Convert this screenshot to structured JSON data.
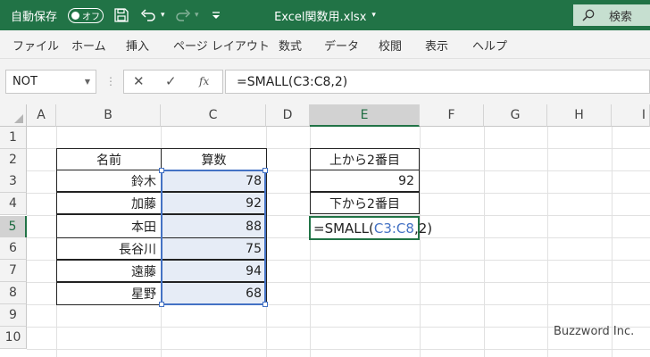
{
  "titlebar": {
    "autosave_label": "自動保存",
    "autosave_state": "オフ",
    "filename": "Excel関数用.xlsx",
    "search_label": "検索",
    "bg_color": "#217346"
  },
  "ribbon": {
    "tabs": [
      "ファイル",
      "ホーム",
      "挿入",
      "ページ レイアウト",
      "数式",
      "データ",
      "校閲",
      "表示",
      "ヘルプ"
    ]
  },
  "formula_bar": {
    "name_box": "NOT",
    "formula": "=SMALL(C3:C8,2)"
  },
  "grid": {
    "columns": [
      "A",
      "B",
      "C",
      "D",
      "E",
      "F",
      "G",
      "H",
      "I"
    ],
    "rows": [
      "1",
      "2",
      "3",
      "4",
      "5",
      "6",
      "7",
      "8",
      "9",
      "10"
    ],
    "active_column": "E",
    "active_row": "5"
  },
  "table": {
    "header_name": "名前",
    "header_score": "算数",
    "rows": [
      {
        "name": "鈴木",
        "score": "78"
      },
      {
        "name": "加藤",
        "score": "92"
      },
      {
        "name": "本田",
        "score": "88"
      },
      {
        "name": "長谷川",
        "score": "75"
      },
      {
        "name": "遠藤",
        "score": "94"
      },
      {
        "name": "星野",
        "score": "68"
      }
    ]
  },
  "side": {
    "label_top": "上から2番目",
    "value_top": "92",
    "label_bottom": "下から2番目",
    "edit_prefix": "=SMALL(",
    "edit_ref": "C3:C8",
    "edit_suffix": ",2)"
  },
  "watermark": "Buzzword Inc."
}
